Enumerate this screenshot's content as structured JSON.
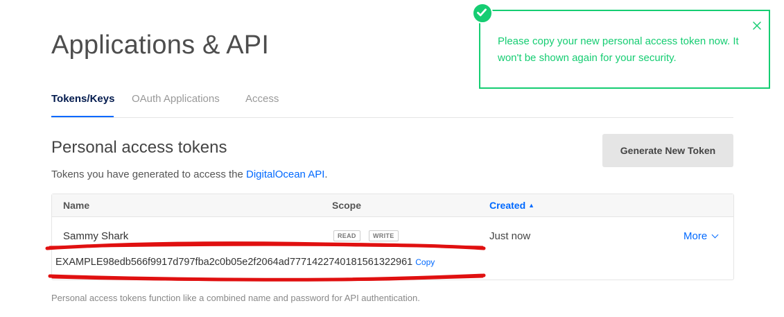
{
  "page": {
    "title": "Applications & API"
  },
  "tabs": [
    {
      "label": "Tokens/Keys",
      "active": true
    },
    {
      "label": "OAuth Applications",
      "active": false
    },
    {
      "label": "Access",
      "active": false
    }
  ],
  "tokens_section": {
    "title": "Personal access tokens",
    "desc_prefix": "Tokens you have generated to access the ",
    "desc_link": "DigitalOcean API",
    "desc_suffix": ".",
    "generate_button": "Generate New Token",
    "footnote": "Personal access tokens function like a combined name and password for API authentication."
  },
  "table": {
    "headers": {
      "name": "Name",
      "scope": "Scope",
      "created": "Created",
      "created_sort_icon": "▲"
    },
    "rows": [
      {
        "name": "Sammy Shark",
        "scopes": [
          "READ",
          "WRITE"
        ],
        "created": "Just now",
        "more_label": "More",
        "token": "EXAMPLE98edb566f9917d797fba2c0b05e2f2064ad7771422740181561322961",
        "copy_label": "Copy"
      }
    ]
  },
  "toast": {
    "message": "Please copy your new personal access token now. It won't be shown again for your security.",
    "icon": "check-circle-icon",
    "close_icon": "close-icon"
  },
  "colors": {
    "accent": "#0069ff",
    "success": "#15cd72",
    "annotation": "#e01010"
  }
}
